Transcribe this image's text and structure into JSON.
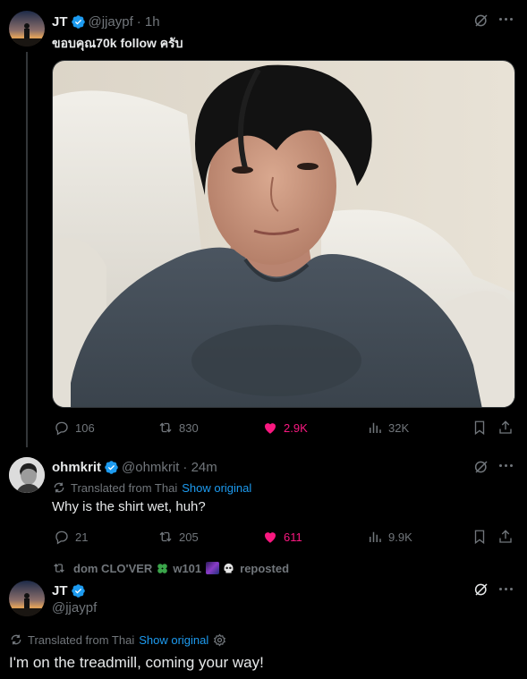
{
  "post1": {
    "name": "JT",
    "handle": "@jjaypf",
    "time": "· 1h",
    "text": "ขอบคุณ70k follow ครับ",
    "stats": {
      "replies": "106",
      "reposts": "830",
      "likes": "2.9K",
      "views": "32K"
    }
  },
  "post2": {
    "name": "ohmkrit",
    "handle": "@ohmkrit",
    "time": "· 24m",
    "translated_label": "Translated from Thai",
    "show_original": "Show original",
    "text": "Why is the shirt wet, huh?",
    "stats": {
      "replies": "21",
      "reposts": "205",
      "likes": "611",
      "views": "9.9K"
    }
  },
  "repost_line": {
    "text_before": "dom CLO'VER",
    "text_mid": "w101",
    "text_after": "reposted"
  },
  "post3": {
    "name": "JT",
    "handle": "@jjaypf",
    "translated_label": "Translated from Thai",
    "show_original": "Show original",
    "text": "I'm on the treadmill, coming your way!"
  },
  "colors": {
    "like": "#f91880",
    "link": "#1d9bf0",
    "verified": "#1d9bf0",
    "muted": "#71767b"
  }
}
